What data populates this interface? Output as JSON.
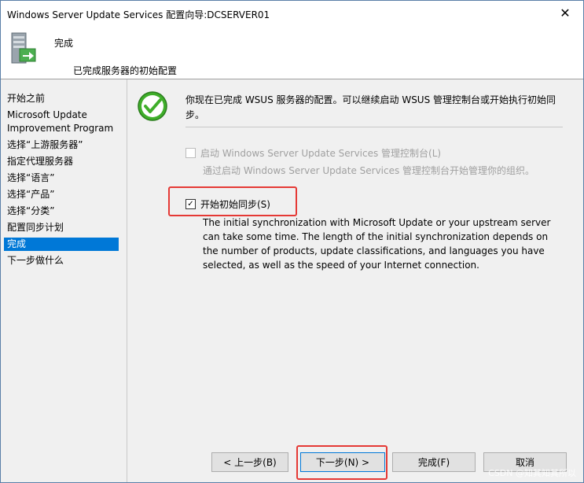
{
  "window": {
    "title": "Windows Server Update Services 配置向导:DCSERVER01",
    "close_glyph": "✕"
  },
  "header": {
    "title": "完成",
    "subtitle": "已完成服务器的初始配置"
  },
  "sidebar": {
    "items": [
      {
        "label": "开始之前",
        "active": false
      },
      {
        "label": "Microsoft Update",
        "active": false
      },
      {
        "label": "Improvement Program",
        "active": false
      },
      {
        "label": "选择“上游服务器”",
        "active": false
      },
      {
        "label": "指定代理服务器",
        "active": false
      },
      {
        "label": "选择“语言”",
        "active": false
      },
      {
        "label": "选择“产品”",
        "active": false
      },
      {
        "label": "选择“分类”",
        "active": false
      },
      {
        "label": "配置同步计划",
        "active": false
      },
      {
        "label": "完成",
        "active": true
      },
      {
        "label": "下一步做什么",
        "active": false
      }
    ]
  },
  "content": {
    "intro": "你现在已完成 WSUS 服务器的配置。可以继续启动 WSUS 管理控制台或开始执行初始同步。",
    "launch_console": {
      "label": "启动 Windows Server Update Services 管理控制台(L)",
      "checked": false,
      "enabled": false,
      "description": "通过启动 Windows Server Update Services 管理控制台开始管理你的组织。"
    },
    "begin_sync": {
      "label": "开始初始同步(S)",
      "checked": true,
      "enabled": true,
      "description": "The initial synchronization with Microsoft Update or your upstream server can take some time. The length of the initial synchronization depends on the number of products, update classifications, and languages you have selected, as well as the speed of your Internet connection."
    }
  },
  "buttons": {
    "back": "< 上一步(B)",
    "next": "下一步(N) >",
    "finish": "完成(F)",
    "cancel": "取消"
  },
  "watermark": "CSDN @知其知其所以",
  "colors": {
    "selection": "#0078d7",
    "highlight_box": "#e53935",
    "success_green": "#3fae2a"
  }
}
